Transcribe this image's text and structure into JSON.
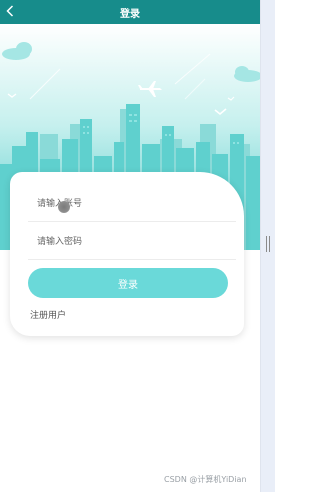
{
  "header": {
    "title": "登录",
    "back_icon": "chevron-left-icon"
  },
  "form": {
    "account_placeholder": "请输入账号",
    "password_placeholder": "请输入密码",
    "login_label": "登录",
    "register_label": "注册用户"
  },
  "watermark": "CSDN @计算机YiDian",
  "colors": {
    "header": "#178c8b",
    "accent": "#6ad9d9",
    "sky_top": "#ffffff",
    "sky_bottom": "#4ec9c8"
  }
}
